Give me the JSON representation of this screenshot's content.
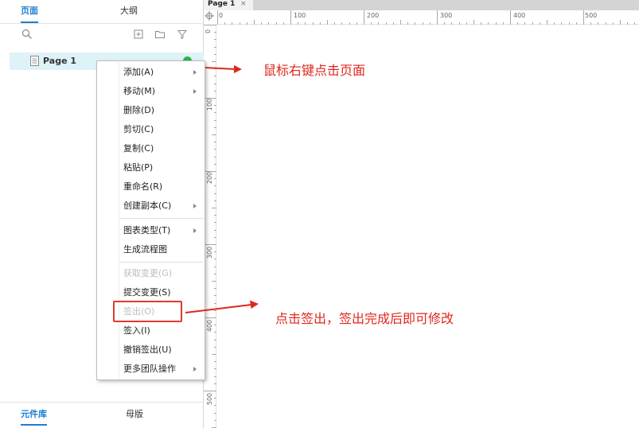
{
  "left_panel": {
    "tabs": [
      {
        "label": "页面",
        "active": true
      },
      {
        "label": "大纲",
        "active": false
      }
    ],
    "toolbar_icons": [
      "search-icon",
      "add-page-icon",
      "add-folder-icon",
      "filter-icon"
    ],
    "pages": [
      {
        "label": "Page 1",
        "selected": true
      }
    ],
    "bottom_tabs": [
      {
        "label": "元件库",
        "active": true
      },
      {
        "label": "母版",
        "active": false
      }
    ]
  },
  "document_tab": {
    "label": "Page 1",
    "close": "×"
  },
  "ruler": {
    "top_labels": [
      "0",
      "100",
      "200",
      "300",
      "400",
      "500"
    ],
    "left_labels": [
      "0",
      "100",
      "200",
      "300",
      "400",
      "500"
    ]
  },
  "context_menu": {
    "items": [
      {
        "label": "添加(A)",
        "submenu": true,
        "disabled": false
      },
      {
        "label": "移动(M)",
        "submenu": true,
        "disabled": false
      },
      {
        "label": "删除(D)",
        "submenu": false,
        "disabled": false
      },
      {
        "label": "剪切(C)",
        "submenu": false,
        "disabled": false
      },
      {
        "label": "复制(C)",
        "submenu": false,
        "disabled": false
      },
      {
        "label": "粘贴(P)",
        "submenu": false,
        "disabled": false
      },
      {
        "label": "重命名(R)",
        "submenu": false,
        "disabled": false
      },
      {
        "label": "创建副本(C)",
        "submenu": true,
        "disabled": false
      },
      {
        "label": "图表类型(T)",
        "submenu": true,
        "disabled": false
      },
      {
        "label": "生成流程图",
        "submenu": false,
        "disabled": false
      },
      {
        "label": "获取变更(G)",
        "submenu": false,
        "disabled": true
      },
      {
        "label": "提交变更(S)",
        "submenu": false,
        "disabled": false
      },
      {
        "label": "签出(O)",
        "submenu": false,
        "disabled": true
      },
      {
        "label": "签入(I)",
        "submenu": false,
        "disabled": false
      },
      {
        "label": "撤销签出(U)",
        "submenu": false,
        "disabled": false
      },
      {
        "label": "更多团队操作",
        "submenu": true,
        "disabled": false
      }
    ]
  },
  "annotations": {
    "right_click_note": "鼠标右键点击页面",
    "checkout_note": "点击签出，签出完成后即可修改",
    "color": "#e0261b"
  },
  "colors": {
    "accent": "#1e7fd0",
    "selected_row": "#def3f7",
    "status_ok": "#2fb04a"
  }
}
